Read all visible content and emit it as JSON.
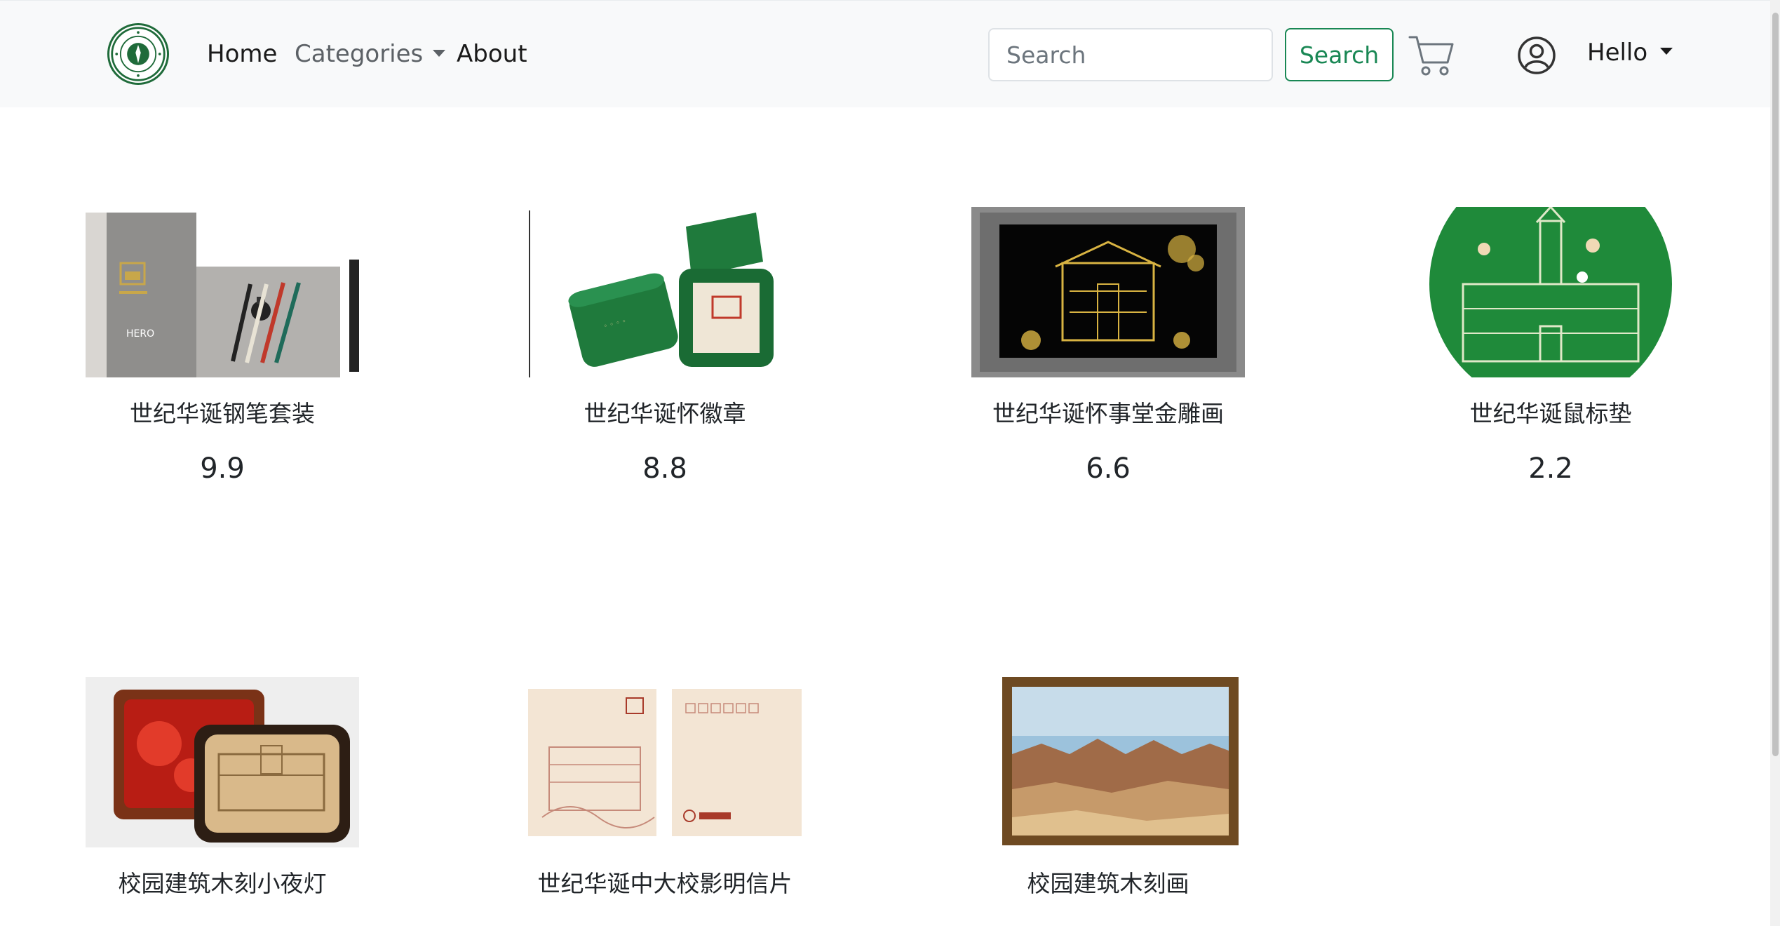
{
  "navbar": {
    "logo": "sysu-logo",
    "home": "Home",
    "categories": "Categories",
    "about": "About",
    "search_placeholder": "Search",
    "search_button": "Search",
    "cart_icon": "cart-icon",
    "user_icon": "user-circle-icon",
    "hello": "Hello"
  },
  "colors": {
    "accent_green": "#198754",
    "navbar_bg": "#f8f9fa",
    "product_green": "#1f7a3c"
  },
  "products": [
    {
      "name": "世纪华诞钢笔套装",
      "price": "9.9"
    },
    {
      "name": "世纪华诞怀徽章",
      "price": "8.8"
    },
    {
      "name": "世纪华诞怀事堂金雕画",
      "price": "6.6"
    },
    {
      "name": "世纪华诞鼠标垫",
      "price": "2.2"
    },
    {
      "name": "校园建筑木刻小夜灯",
      "price": ""
    },
    {
      "name": "世纪华诞中大校影明信片",
      "price": ""
    },
    {
      "name": "校园建筑木刻画",
      "price": ""
    }
  ]
}
